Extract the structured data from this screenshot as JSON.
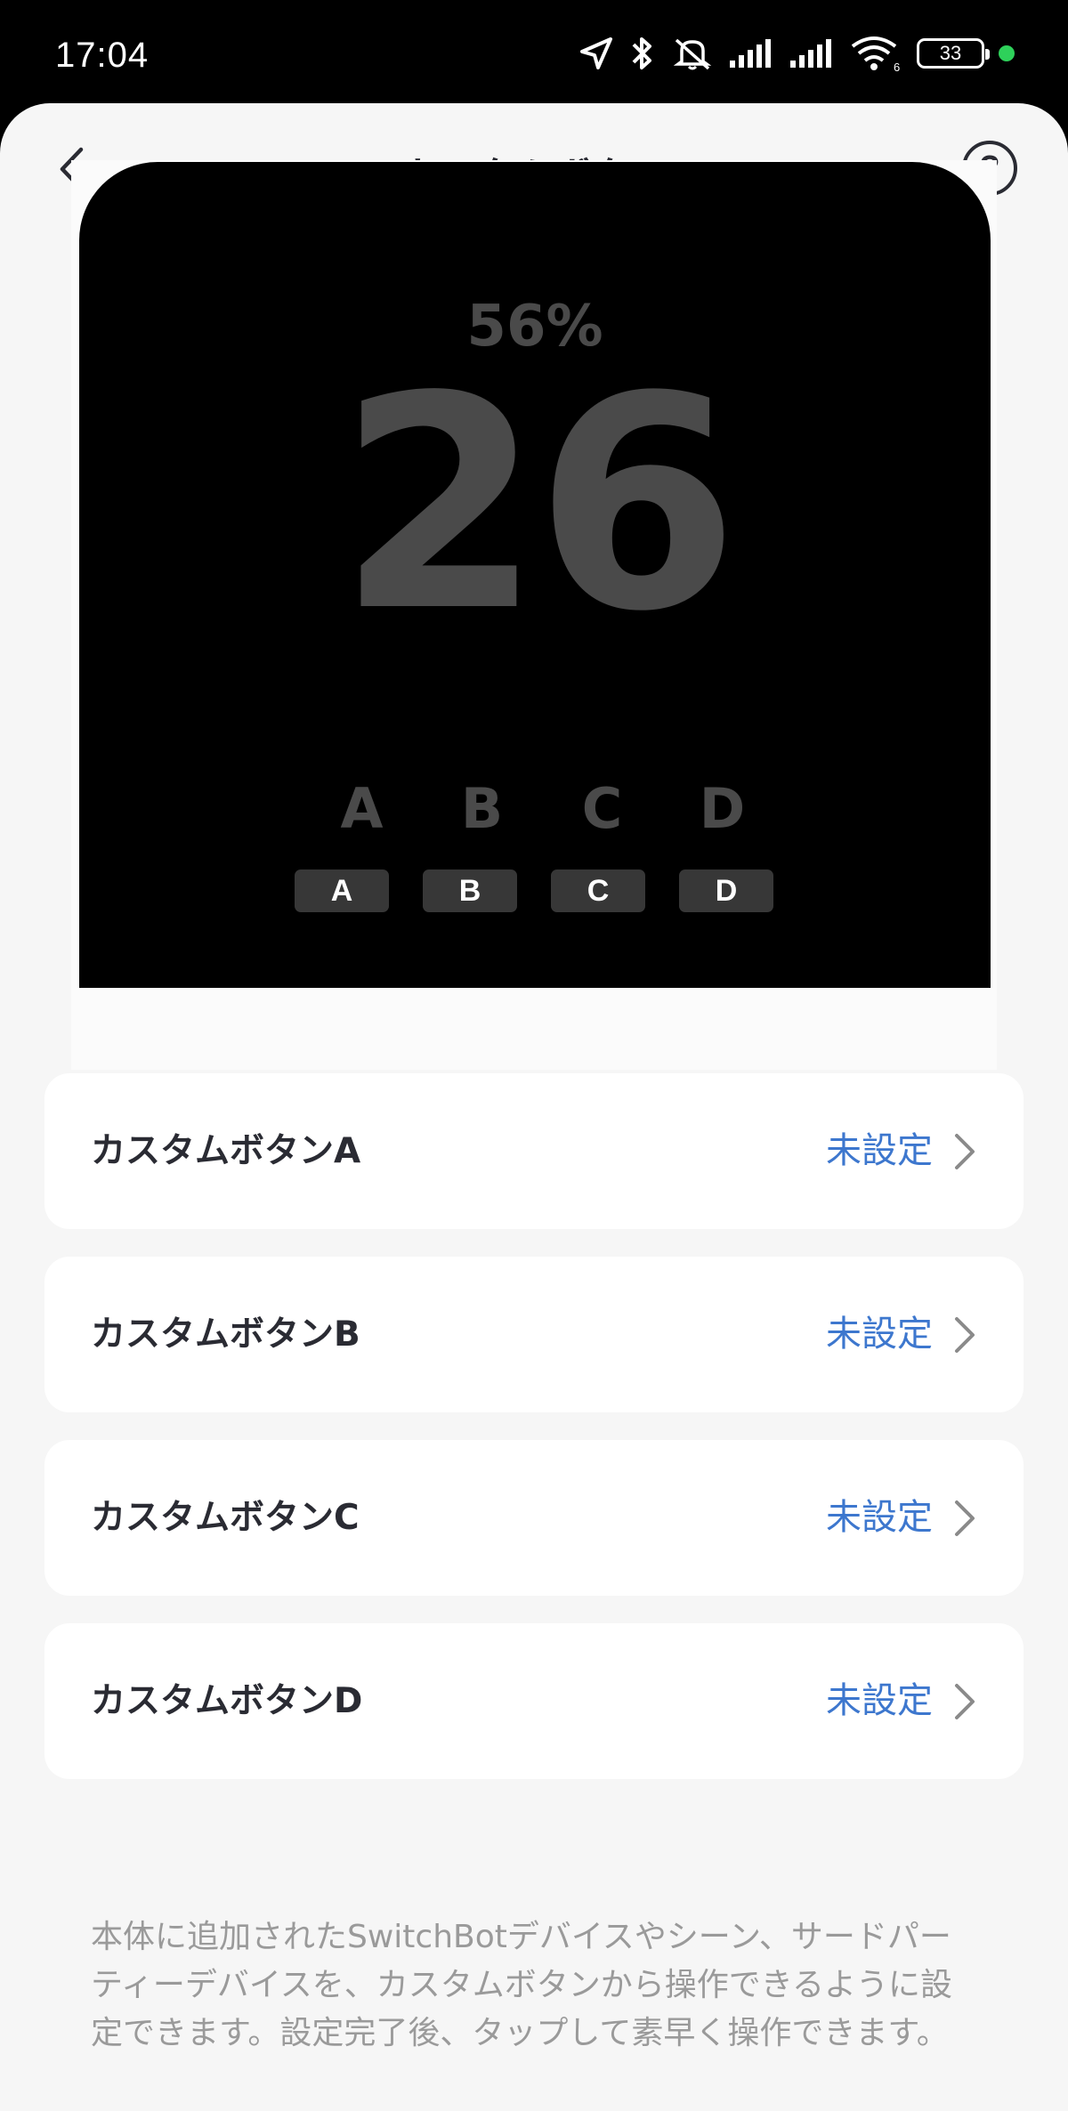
{
  "status_bar": {
    "time": "17:04",
    "battery_level": "33",
    "icons": [
      "location-icon",
      "bluetooth-icon",
      "silent-icon",
      "signal-icon",
      "signal-icon",
      "wifi-icon",
      "battery-icon",
      "active-dot"
    ],
    "wifi_badge": "6"
  },
  "header": {
    "title": "カスタムボタン",
    "back_icon": "chevron-left-icon",
    "help_icon": "help-icon",
    "help_glyph": "?"
  },
  "preview": {
    "humidity": "56%",
    "temperature": "26",
    "letters": [
      "A",
      "B",
      "C",
      "D"
    ],
    "keys": [
      "A",
      "B",
      "C",
      "D"
    ]
  },
  "buttons": [
    {
      "label": "カスタムボタンA",
      "value": "未設定"
    },
    {
      "label": "カスタムボタンB",
      "value": "未設定"
    },
    {
      "label": "カスタムボタンC",
      "value": "未設定"
    },
    {
      "label": "カスタムボタンD",
      "value": "未設定"
    }
  ],
  "note": "本体に追加されたSwitchBotデバイスやシーン、サードパーティーデバイスを、カスタムボタンから操作できるように設定できます。設定完了後、タップして素早く操作できます。",
  "colors": {
    "accent": "#3d77ce",
    "status_dot": "#2ed15a",
    "background": "#f6f6f6"
  }
}
